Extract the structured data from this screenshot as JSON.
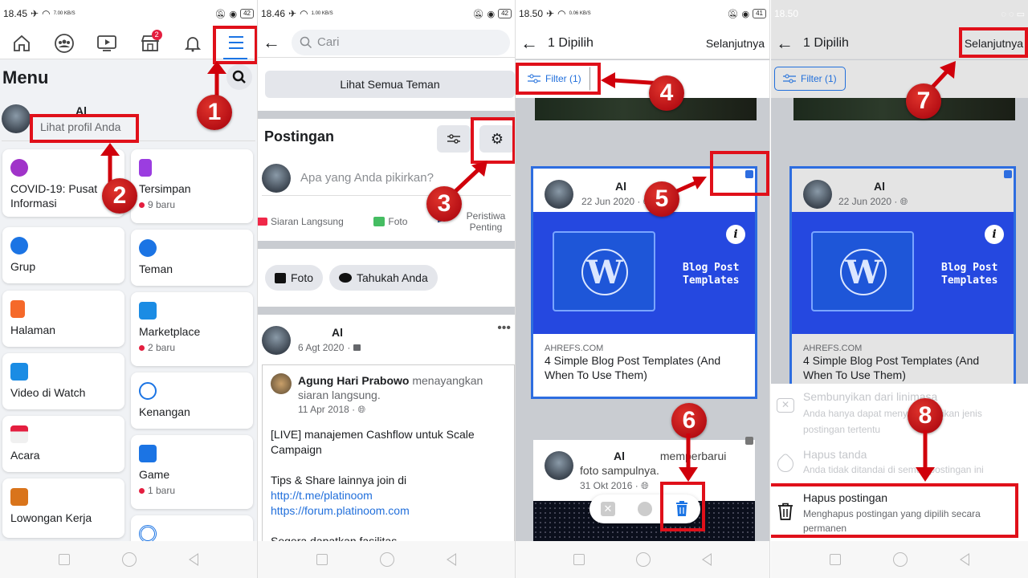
{
  "panel1": {
    "status": {
      "time": "18.45",
      "speed": "7.00 KB/S",
      "battery": "42"
    },
    "topnav": [
      {
        "name": "home",
        "label": ""
      },
      {
        "name": "groups",
        "label": ""
      },
      {
        "name": "watch",
        "label": ""
      },
      {
        "name": "marketplace",
        "label": "",
        "badge": "2"
      },
      {
        "name": "notifications",
        "label": ""
      },
      {
        "name": "menu",
        "label": ""
      }
    ],
    "menu_title": "Menu",
    "profile": {
      "name": "Al",
      "subtitle": "Lihat profil Anda"
    },
    "left_cards": [
      {
        "label": "COVID-19: Pusat Informasi",
        "icon": "covid-heart-icon",
        "color": "#a033c9"
      },
      {
        "label": "Grup",
        "icon": "groups-icon",
        "color": "#1b74e4"
      },
      {
        "label": "Halaman",
        "icon": "flag-icon",
        "color": "#f5692a"
      },
      {
        "label": "Video di Watch",
        "icon": "watch-tv-icon",
        "color": "#1b8ce4"
      },
      {
        "label": "Acara",
        "icon": "calendar-star-icon",
        "color": "#e41e3f"
      },
      {
        "label": "Lowongan Kerja",
        "icon": "briefcase-icon",
        "color": "#d9741b"
      }
    ],
    "right_cards": [
      {
        "label": "Tersimpan",
        "sub": "9 baru",
        "icon": "bookmark-icon",
        "color": "#9b3de0"
      },
      {
        "label": "Teman",
        "sub": "",
        "icon": "friends-icon",
        "color": "#1b74e4"
      },
      {
        "label": "Marketplace",
        "sub": "2 baru",
        "icon": "shop-icon",
        "color": "#1b8ce4"
      },
      {
        "label": "Kenangan",
        "sub": "",
        "icon": "memories-clock-icon",
        "color": "#1b74e4"
      },
      {
        "label": "Game",
        "sub": "1 baru",
        "icon": "gaming-icon",
        "color": "#1b74e4"
      },
      {
        "label": "",
        "sub": "",
        "icon": "live-icon",
        "color": "#1b74e4"
      }
    ]
  },
  "panel2": {
    "status": {
      "time": "18.46",
      "speed": "1.00 KB/S",
      "battery": "42"
    },
    "search_placeholder": "Cari",
    "see_all_friends": "Lihat Semua Teman",
    "posts_title": "Postingan",
    "composer_placeholder": "Apa yang Anda pikirkan?",
    "composer_actions": [
      {
        "label": "Siaran Langsung",
        "icon": "live-video-icon"
      },
      {
        "label": "Foto",
        "icon": "photo-icon"
      },
      {
        "label": "Peristiwa Penting",
        "icon": "life-event-flag-icon"
      }
    ],
    "chips": [
      {
        "label": "Foto",
        "icon": "photo-icon"
      },
      {
        "label": "Tahukah Anda",
        "icon": "speech-bubble-icon"
      }
    ],
    "post": {
      "author": "Al",
      "date": "6 Agt 2020",
      "privacy": "lock",
      "shared": {
        "author": "Agung Hari Prabowo",
        "action": "menayangkan siaran langsung.",
        "date": "11 Apr 2018",
        "privacy": "globe",
        "line1": "[LIVE] manajemen Cashflow untuk Scale Campaign",
        "line2": "Tips & Share lainnya join di",
        "link1": "http://t.me/platinoom",
        "link2": "https://forum.platinoom.com",
        "line3": "Segera dapatkan fasilitas..."
      }
    }
  },
  "panel3": {
    "status": {
      "time": "18.50",
      "speed": "0.06 KB/S",
      "battery": "41"
    },
    "title": "1 Dipilih",
    "next": "Selanjutnya",
    "filter": "Filter (1)",
    "card1": {
      "author": "Al",
      "date": "22 Jun 2020",
      "image_text_1": "Blog Post",
      "image_text_2": "Templates",
      "domain": "AHREFS.COM",
      "link_title": "4 Simple Blog Post Templates (And When To Use Them)"
    },
    "card2": {
      "author": "Al",
      "action": "memperbarui",
      "action2": "foto sampulnya.",
      "date": "31 Okt 2016"
    }
  },
  "panel4": {
    "status": {
      "time": "18.50"
    },
    "title": "1 Dipilih",
    "next": "Selanjutnya",
    "filter": "Filter (1)",
    "card": {
      "author": "Al",
      "date": "22 Jun 2020",
      "image_text_1": "Blog Post",
      "image_text_2": "Templates",
      "domain": "AHREFS.COM",
      "link_title": "4 Simple Blog Post Templates (And When To Use Them)"
    },
    "sheet": [
      {
        "title": "Sembunyikan dari linimasa",
        "desc": "Anda hanya dapat menyembunyikan jenis postingan tertentu",
        "enabled": false,
        "icon": "hide-x-icon"
      },
      {
        "title": "Hapus tanda",
        "desc": "Anda tidak ditandai di semua postingan ini",
        "enabled": false,
        "icon": "remove-tag-icon"
      },
      {
        "title": "Hapus postingan",
        "desc": "Menghapus postingan yang dipilih secara permanen",
        "enabled": true,
        "icon": "trash-icon"
      }
    ]
  },
  "annotations": [
    "1",
    "2",
    "3",
    "4",
    "5",
    "6",
    "7",
    "8"
  ],
  "colors": {
    "accent": "#1b74e4",
    "annotation_red": "#e0101a",
    "selection_blue": "#2d6de0",
    "blog_blue": "#2548e0"
  }
}
